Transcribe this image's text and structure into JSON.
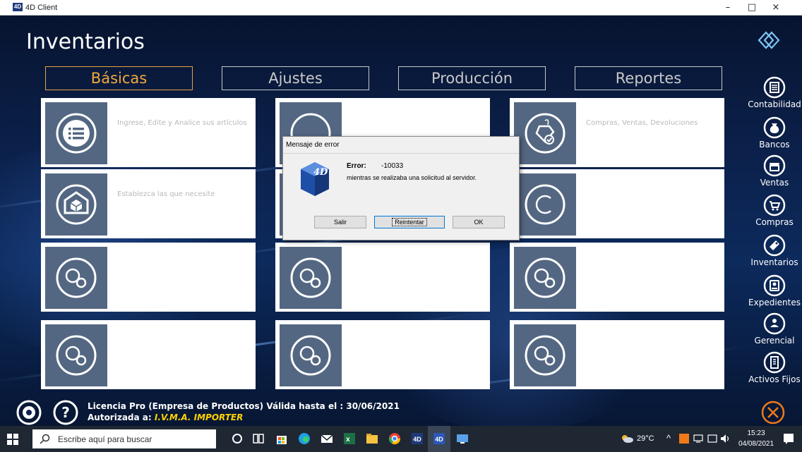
{
  "window": {
    "title": "4D Client",
    "app_icon_text": "4D",
    "minimize": "–",
    "maximize": "□",
    "close": "×"
  },
  "page": {
    "title": "Inventarios"
  },
  "tabs": [
    {
      "label": "Básicas",
      "active": true
    },
    {
      "label": "Ajustes",
      "active": false
    },
    {
      "label": "Producción",
      "active": false
    },
    {
      "label": "Reportes",
      "active": false
    }
  ],
  "tiles": [
    {
      "icon": "list-icon",
      "desc": "Ingrese, Edite y Analice sus artículos"
    },
    {
      "icon": "tag-check-icon",
      "desc": "Compras, Ventas, Devoluciones"
    },
    {
      "icon": "box-home-icon",
      "desc": "Establezca las que necesite"
    },
    {
      "icon": "copyright-c-icon",
      "desc": ""
    }
  ],
  "sidebar": {
    "items": [
      {
        "label": "Contabilidad",
        "icon": "ledger-icon"
      },
      {
        "label": "Bancos",
        "icon": "money-bag-icon"
      },
      {
        "label": "Ventas",
        "icon": "store-icon"
      },
      {
        "label": "Compras",
        "icon": "cart-icon"
      },
      {
        "label": "Inventarios",
        "icon": "tag-icon"
      },
      {
        "label": "Expedientes",
        "icon": "id-card-icon"
      },
      {
        "label": "Gerencial",
        "icon": "manager-icon"
      },
      {
        "label": "Activos Fijos",
        "icon": "building-icon"
      }
    ]
  },
  "footer": {
    "license_line": "Licencia Pro (Empresa de Productos) Válida hasta el : 30/06/2021",
    "authorized_label": "Autorizada a:",
    "authorized_company": "I.V.M.A. IMPORTER"
  },
  "dialog": {
    "title": "Mensaje de error",
    "error_label": "Error:",
    "error_code": "-10033",
    "message": "mientras se realizaba una solicitud al servidor.",
    "buttons": {
      "quit": "Salir",
      "retry": "Reintentar",
      "ok": "OK"
    }
  },
  "taskbar": {
    "search_placeholder": "Escribe aquí para buscar",
    "weather": "29°C",
    "time": "15:23",
    "date": "04/08/2021",
    "colors": {
      "bar": "#1f2733",
      "accent_active_tab": "#f2a93b",
      "license_company": "#ffd100"
    }
  }
}
